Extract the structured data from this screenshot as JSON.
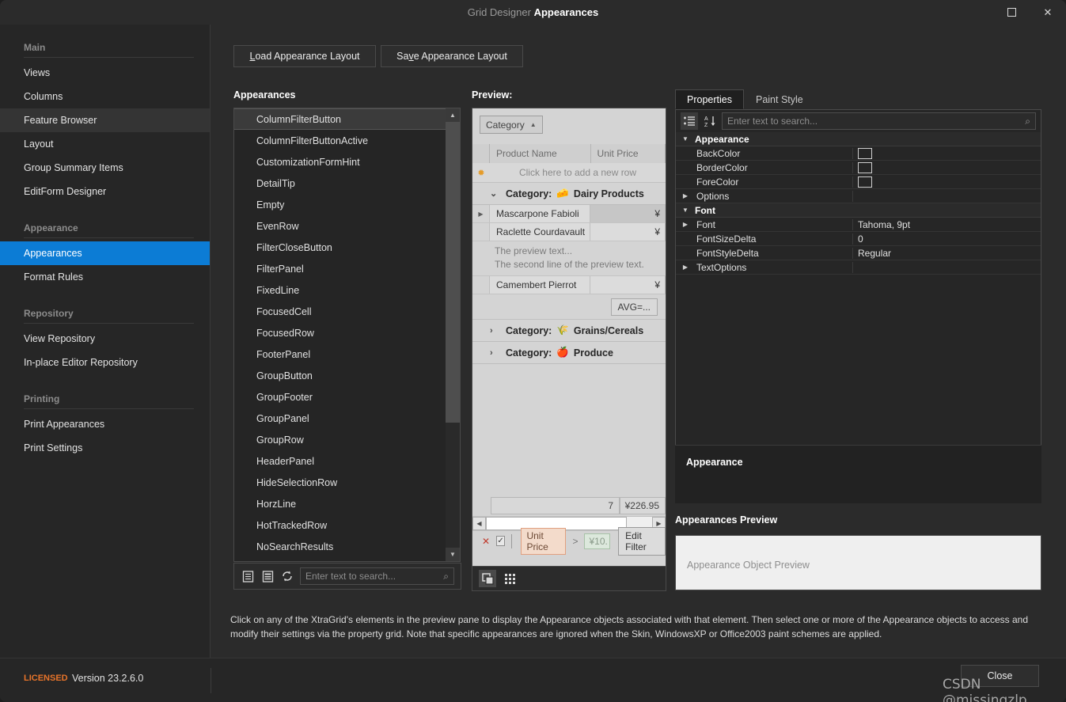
{
  "window": {
    "app_name": "Grid Designer",
    "page_name": "Appearances",
    "maximize_icon": "maximize-icon",
    "close_icon": "close-icon"
  },
  "sidebar": {
    "groups": [
      {
        "title": "Main",
        "items": [
          {
            "label": "Views",
            "state": "normal"
          },
          {
            "label": "Columns",
            "state": "normal"
          },
          {
            "label": "Feature Browser",
            "state": "hover"
          },
          {
            "label": "Layout",
            "state": "normal"
          },
          {
            "label": "Group Summary Items",
            "state": "normal"
          },
          {
            "label": "EditForm Designer",
            "state": "normal"
          }
        ]
      },
      {
        "title": "Appearance",
        "items": [
          {
            "label": "Appearances",
            "state": "active"
          },
          {
            "label": "Format Rules",
            "state": "normal"
          }
        ]
      },
      {
        "title": "Repository",
        "items": [
          {
            "label": "View Repository",
            "state": "normal"
          },
          {
            "label": "In-place Editor Repository",
            "state": "normal"
          }
        ]
      },
      {
        "title": "Printing",
        "items": [
          {
            "label": "Print Appearances",
            "state": "normal"
          },
          {
            "label": "Print Settings",
            "state": "normal"
          }
        ]
      }
    ]
  },
  "toolbar": {
    "load_layout_mnemonic": "L",
    "load_layout_rest": "oad Appearance Layout",
    "save_layout_pre": "Sa",
    "save_layout_mnemonic": "v",
    "save_layout_rest": "e Appearance Layout"
  },
  "appearances_panel": {
    "label": "Appearances",
    "selected": "ColumnFilterButton",
    "items": [
      "ColumnFilterButton",
      "ColumnFilterButtonActive",
      "CustomizationFormHint",
      "DetailTip",
      "Empty",
      "EvenRow",
      "FilterCloseButton",
      "FilterPanel",
      "FixedLine",
      "FocusedCell",
      "FocusedRow",
      "FooterPanel",
      "GroupButton",
      "GroupFooter",
      "GroupPanel",
      "GroupRow",
      "HeaderPanel",
      "HideSelectionRow",
      "HorzLine",
      "HotTrackedRow",
      "NoSearchResults"
    ],
    "search_placeholder": "Enter text to search...",
    "search_value": "",
    "toolbar_icons": [
      "list-view-icon",
      "detail-view-icon",
      "refresh-icon",
      "search-icon"
    ]
  },
  "preview_panel": {
    "label": "Preview:",
    "group_panel_chip": "Category",
    "group_panel_sort_icon": "sort-ascending-icon",
    "columns": [
      "Product Name",
      "Unit Price"
    ],
    "new_row_text": "Click here to add a new row",
    "new_row_icon": "new-row-asterisk-icon",
    "groups": [
      {
        "caption_prefix": "Category:",
        "name": "Dairy Products",
        "icon": "cheese-icon",
        "expanded": true,
        "rows": [
          {
            "product": "Mascarpone Fabioli",
            "price": "¥",
            "focused": true
          },
          {
            "product": "Raclette Courdavault",
            "price": "¥",
            "focused": false
          },
          {
            "product": "Camembert Pierrot",
            "price": "¥",
            "focused": false
          }
        ],
        "preview_text_line1": "The preview text...",
        "preview_text_line2": "The second line of the preview text.",
        "footer_summary": "AVG=..."
      },
      {
        "caption_prefix": "Category:",
        "name": "Grains/Cereals",
        "icon": "grain-icon",
        "expanded": false,
        "rows": []
      },
      {
        "caption_prefix": "Category:",
        "name": "Produce",
        "icon": "apple-icon",
        "expanded": false,
        "rows": []
      }
    ],
    "grid_footer": {
      "count": "7",
      "sum": "¥226.95"
    },
    "filter_panel": {
      "close_icon": "filter-close-icon",
      "enabled_checkbox": "checked",
      "field": "Unit Price",
      "operator": ">",
      "value": "¥10.",
      "edit_button": "Edit Filter"
    },
    "bottom_icons": [
      "overlay-views-icon",
      "grid-layout-icon"
    ]
  },
  "properties_panel": {
    "tabs": [
      {
        "label": "Properties",
        "active": true
      },
      {
        "label": "Paint Style",
        "active": false
      }
    ],
    "tool_icons": [
      "categorized-icon",
      "alphabetical-sort-icon"
    ],
    "search_placeholder": "Enter text to search...",
    "search_value": "",
    "categories": [
      {
        "name": "Appearance",
        "rows": [
          {
            "name": "BackColor",
            "value": "",
            "type": "color",
            "expandable": false
          },
          {
            "name": "BorderColor",
            "value": "",
            "type": "color",
            "expandable": false
          },
          {
            "name": "ForeColor",
            "value": "",
            "type": "color",
            "expandable": false
          },
          {
            "name": "Options",
            "value": "",
            "type": "text",
            "expandable": true
          }
        ]
      },
      {
        "name": "Font",
        "rows": [
          {
            "name": "Font",
            "value": "Tahoma, 9pt",
            "type": "text",
            "expandable": true
          },
          {
            "name": "FontSizeDelta",
            "value": "0",
            "type": "text",
            "expandable": false
          },
          {
            "name": "FontStyleDelta",
            "value": "Regular",
            "type": "text",
            "expandable": false
          },
          {
            "name": "TextOptions",
            "value": "",
            "type": "text",
            "expandable": true
          }
        ]
      }
    ],
    "description_title": "Appearance",
    "appearances_preview_title": "Appearances Preview",
    "appearances_preview_placeholder": "Appearance Object Preview"
  },
  "footer_description": "Click on any of the XtraGrid's elements in the preview pane to display the Appearance objects associated with that element. Then select one or more of the Appearance objects to access and modify their settings via the property grid. Note that specific appearances are ignored when the Skin, WindowsXP or Office2003 paint schemes are applied.",
  "status_bar": {
    "license": "LICENSED",
    "version": "Version 23.2.6.0",
    "close_button": "Close"
  },
  "watermark": "CSDN @missingzlp",
  "colors": {
    "accent": "#0c7cd5",
    "license_orange": "#e8742a",
    "window_bg": "#2b2b2b",
    "sidebar_bg": "#262626",
    "preview_bg": "#d4d4d4"
  }
}
